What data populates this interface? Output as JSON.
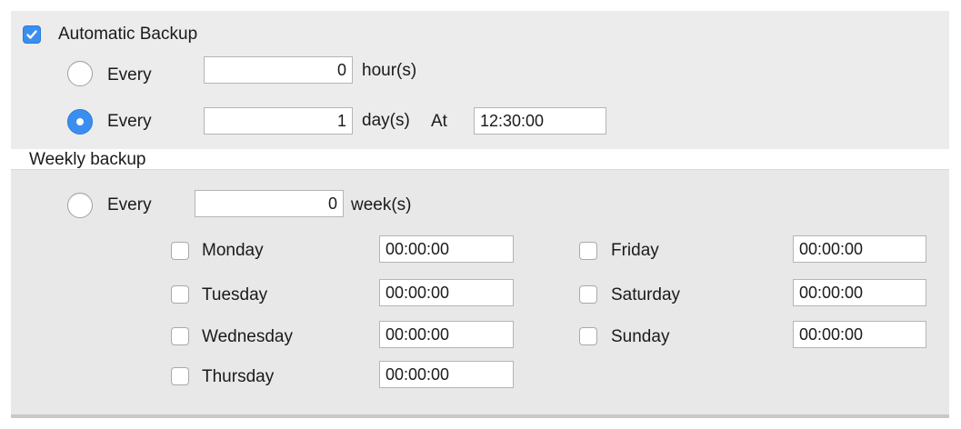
{
  "auto_backup": {
    "label": "Automatic Backup",
    "checked": true
  },
  "hourly": {
    "label": "Every",
    "value": "0",
    "unit": "hour(s)",
    "selected": false
  },
  "daily": {
    "label": "Every",
    "value": "1",
    "unit": "day(s)",
    "at_label": "At",
    "time": "12:30:00",
    "selected": true
  },
  "weekly": {
    "section_label": "Weekly backup",
    "label": "Every",
    "value": "0",
    "unit": "week(s)",
    "selected": false,
    "days": [
      {
        "name": "Monday",
        "time": "00:00:00",
        "checked": false
      },
      {
        "name": "Tuesday",
        "time": "00:00:00",
        "checked": false
      },
      {
        "name": "Wednesday",
        "time": "00:00:00",
        "checked": false
      },
      {
        "name": "Thursday",
        "time": "00:00:00",
        "checked": false
      },
      {
        "name": "Friday",
        "time": "00:00:00",
        "checked": false
      },
      {
        "name": "Saturday",
        "time": "00:00:00",
        "checked": false
      },
      {
        "name": "Sunday",
        "time": "00:00:00",
        "checked": false
      }
    ]
  },
  "colors": {
    "accent": "#3a8ef0",
    "panel": "#ececec"
  }
}
